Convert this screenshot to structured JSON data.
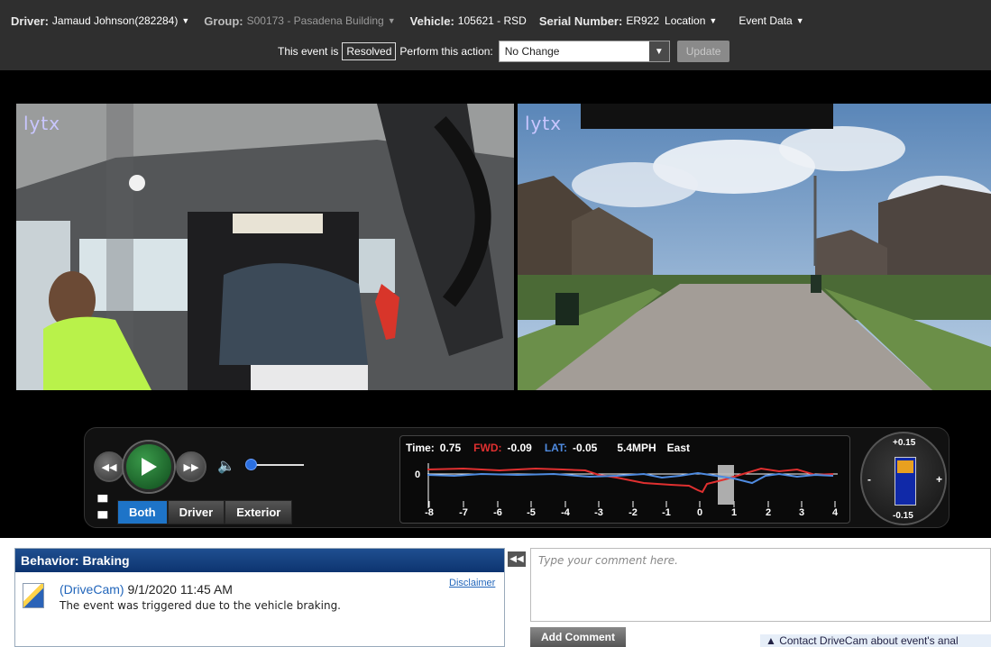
{
  "header": {
    "driver_label": "Driver:",
    "driver_value": "Jamaud Johnson(282284)",
    "group_label": "Group:",
    "group_value": "S00173 - Pasadena Building",
    "vehicle_label": "Vehicle:",
    "vehicle_value": "105621 - RSD",
    "serial_label": "Serial Number:",
    "serial_value": "ER922",
    "location_label": "Location",
    "event_data_label": "Event Data",
    "event_status_prefix": "This event is",
    "event_status": "Resolved",
    "action_label": "Perform this action:",
    "action_value": "No Change",
    "update_label": "Update"
  },
  "videos": {
    "driver_logo": "lytx",
    "exterior_logo": "lytx"
  },
  "player": {
    "time_label": "Time:",
    "time_value": "0.75",
    "fwd_label": "FWD:",
    "fwd_value": "-0.09",
    "lat_label": "LAT:",
    "lat_value": "-0.05",
    "speed": "5.4MPH",
    "heading": "East",
    "zero_label": "0",
    "ticks": [
      "-8",
      "-7",
      "-6",
      "-5",
      "-4",
      "-3",
      "-2",
      "-1",
      "0",
      "1",
      "2",
      "3",
      "4"
    ],
    "tabs": [
      "Both",
      "Driver",
      "Exterior"
    ],
    "active_tab": "Both",
    "gauge_top": "+0.15",
    "gauge_bottom": "-0.15",
    "gauge_minus": "-",
    "gauge_plus": "+",
    "colors": {
      "fwd": "#e03030",
      "lat": "#4f8be0",
      "active_tab": "#1e74c8",
      "play": "#1e7a34"
    }
  },
  "behavior": {
    "title": "Behavior: Braking",
    "source": "(DriveCam)",
    "datetime": "9/1/2020 11:45 AM",
    "description": "The event was triggered due to the vehicle braking.",
    "disclaimer": "Disclaimer"
  },
  "comments": {
    "placeholder": "Type your comment here.",
    "add_label": "Add Comment",
    "contact_label": "Contact DriveCam about event's anal"
  }
}
